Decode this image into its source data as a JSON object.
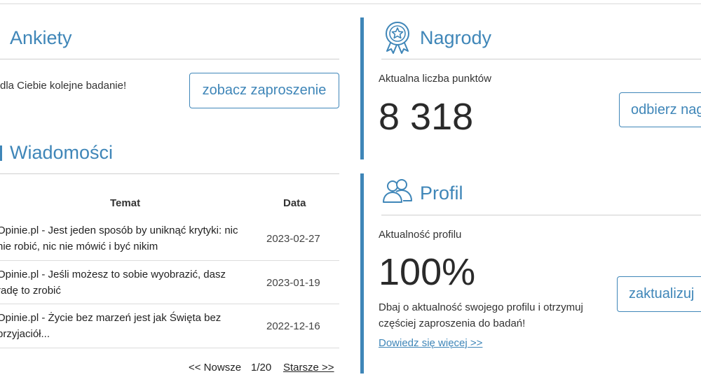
{
  "colors": {
    "accent": "#3f86b8",
    "text": "#333333",
    "rule": "#cfcfcf"
  },
  "ankiety": {
    "title": "Ankiety",
    "message": "dla Ciebie kolejne badanie!",
    "button_label": "zobacz zaproszenie"
  },
  "wiadomosci": {
    "title": "Wiadomości",
    "columns": {
      "topic": "Temat",
      "date": "Data"
    },
    "rows": [
      {
        "topic": "Opinie.pl - Jest jeden sposób by uniknąć krytyki: nic nie robić, nic nie mówić i być nikim",
        "date": "2023-02-27"
      },
      {
        "topic": "Opinie.pl - Jeśli możesz to sobie wyobrazić, dasz radę to zrobić",
        "date": "2023-01-19"
      },
      {
        "topic": "Opinie.pl - Życie bez marzeń jest jak Święta bez przyjaciół...",
        "date": "2022-12-16"
      }
    ],
    "pager": {
      "newer": "<< Nowsze",
      "count": "1/20",
      "older": "Starsze >>"
    }
  },
  "nagrody": {
    "icon": "award-ribbon-icon",
    "title": "Nagrody",
    "points_label": "Aktualna liczba punktów",
    "points_value": "8 318",
    "button_label": "odbierz nagrodę"
  },
  "profil": {
    "icon": "users-icon",
    "title": "Profil",
    "status_label": "Aktualność profilu",
    "status_value": "100%",
    "button_label": "zaktualizuj",
    "description": "Dbaj o aktualność swojego profilu i otrzymuj częściej zaproszenia do badań!",
    "link_label": "Dowiedz się więcej >>"
  }
}
